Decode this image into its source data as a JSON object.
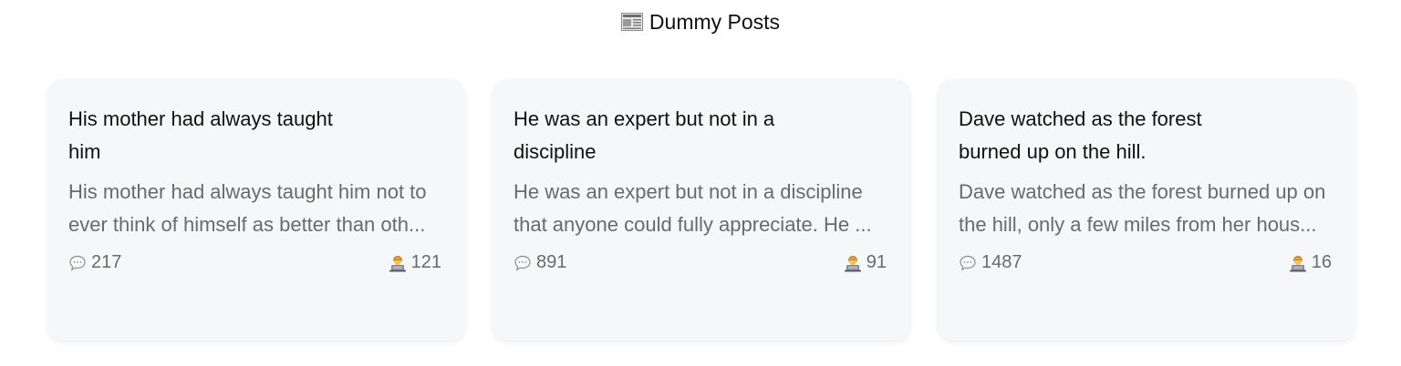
{
  "header": {
    "icon": "newspaper-icon",
    "title": "Dummy Posts"
  },
  "posts": [
    {
      "title": "His mother had always taught him",
      "excerpt": "His mother had always taught him not to ever think of himself as better than oth...",
      "comments": "217",
      "author_count": "121",
      "comment_icon": "speech-bubble-icon",
      "author_icon": "technologist-icon"
    },
    {
      "title": "He was an expert but not in a discipline",
      "excerpt": "He was an expert but not in a discipline that anyone could fully appreciate. He ...",
      "comments": "891",
      "author_count": "91",
      "comment_icon": "speech-bubble-icon",
      "author_icon": "technologist-icon"
    },
    {
      "title": "Dave watched as the forest burned up on the hill.",
      "excerpt": "Dave watched as the forest burned up on the hill, only a few miles from her hous...",
      "comments": "1487",
      "author_count": "16",
      "comment_icon": "speech-bubble-icon",
      "author_icon": "technologist-icon"
    }
  ]
}
